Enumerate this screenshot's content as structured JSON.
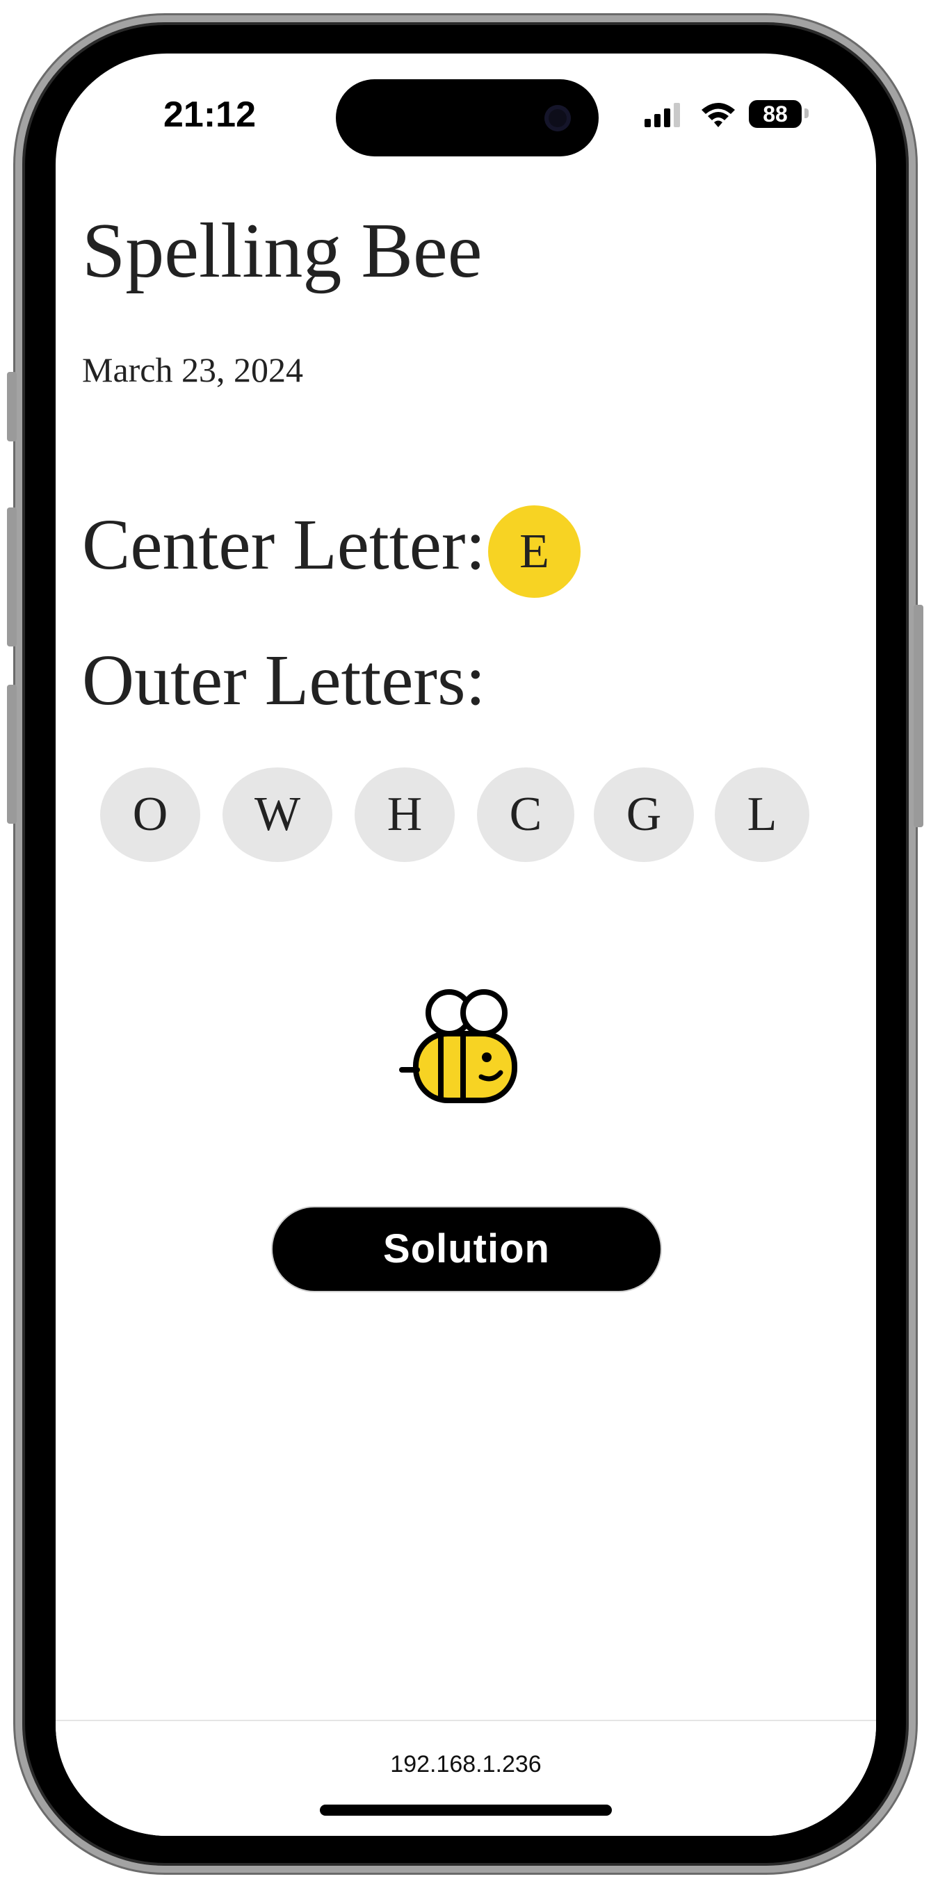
{
  "status_bar": {
    "time": "21:12",
    "battery": "88"
  },
  "app": {
    "title": "Spelling Bee",
    "date": "March 23, 2024"
  },
  "puzzle": {
    "center_label": "Center Letter:",
    "center_letter": "E",
    "outer_label": "Outer Letters:",
    "outer_letters": [
      "O",
      "W",
      "H",
      "C",
      "G",
      "L"
    ]
  },
  "actions": {
    "solution_label": "Solution"
  },
  "browser": {
    "url": "192.168.1.236"
  },
  "colors": {
    "accent_yellow": "#f7d323",
    "chip_gray": "#e6e6e6",
    "text": "#222222"
  },
  "icons": [
    "signal-icon",
    "wifi-icon",
    "battery-icon",
    "bee-icon"
  ]
}
